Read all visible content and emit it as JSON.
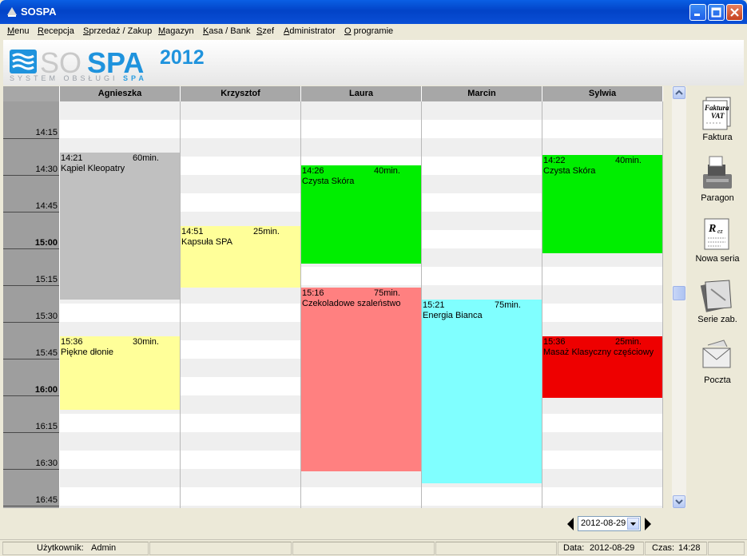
{
  "window": {
    "title": "SOSPA"
  },
  "menu": [
    "Menu",
    "Recepcja",
    "Sprzedaż / Zakup",
    "Magazyn",
    "Kasa / Bank",
    "Szef",
    "Administrator",
    "O programie"
  ],
  "logo": {
    "so": "SO",
    "spa": "SPA",
    "year": "2012",
    "sub_a": "SYSTEM OBSŁUGI",
    "sub_b": "SPA"
  },
  "schedule": {
    "staff": [
      "Agnieszka",
      "Krzysztof",
      "Laura",
      "Marcin",
      "Sylwia"
    ],
    "times": [
      {
        "label": "14:15",
        "hour": false
      },
      {
        "label": "14:30",
        "hour": false
      },
      {
        "label": "14:45",
        "hour": false
      },
      {
        "label": "15:00",
        "hour": true
      },
      {
        "label": "15:15",
        "hour": false
      },
      {
        "label": "15:30",
        "hour": false
      },
      {
        "label": "15:45",
        "hour": false
      },
      {
        "label": "16:00",
        "hour": true
      },
      {
        "label": "16:15",
        "hour": false
      },
      {
        "label": "16:30",
        "hour": false
      },
      {
        "label": "16:45",
        "hour": false
      }
    ],
    "appointments": [
      {
        "staff": "Agnieszka",
        "time": "14:21",
        "duration": "60min.",
        "name": "Kąpiel Kleopatry",
        "color": "#c0c0c0"
      },
      {
        "staff": "Agnieszka",
        "time": "15:36",
        "duration": "30min.",
        "name": "Piękne dłonie",
        "color": "#ffff99"
      },
      {
        "staff": "Krzysztof",
        "time": "14:51",
        "duration": "25min.",
        "name": "Kapsuła SPA",
        "color": "#ffff99"
      },
      {
        "staff": "Laura",
        "time": "14:26",
        "duration": "40min.",
        "name": "Czysta Skóra",
        "color": "#00ee00"
      },
      {
        "staff": "Laura",
        "time": "15:16",
        "duration": "75min.",
        "name": "Czekoladowe szaleństwo",
        "color": "#ff8080"
      },
      {
        "staff": "Marcin",
        "time": "15:21",
        "duration": "75min.",
        "name": "Energia Bianca",
        "color": "#80ffff"
      },
      {
        "staff": "Sylwia",
        "time": "14:22",
        "duration": "40min.",
        "name": "Czysta Skóra",
        "color": "#00ee00"
      },
      {
        "staff": "Sylwia",
        "time": "15:36",
        "duration": "25min.",
        "name": "Masaż Klasyczny częściowy",
        "color": "#ee0000"
      }
    ]
  },
  "toolbar": [
    {
      "label": "Faktura",
      "icon": "invoice-icon"
    },
    {
      "label": "Paragon",
      "icon": "cash-register-icon"
    },
    {
      "label": "Nowa seria",
      "icon": "new-series-icon"
    },
    {
      "label": "Serie zab.",
      "icon": "treatment-series-icon"
    },
    {
      "label": "Poczta",
      "icon": "mail-icon"
    }
  ],
  "date_selector": {
    "value": "2012-08-29"
  },
  "status": {
    "user_label": "Użytkownik:",
    "user": "Admin",
    "date_label": "Data:",
    "date": "2012-08-29",
    "time_label": "Czas:",
    "time": "14:28"
  }
}
